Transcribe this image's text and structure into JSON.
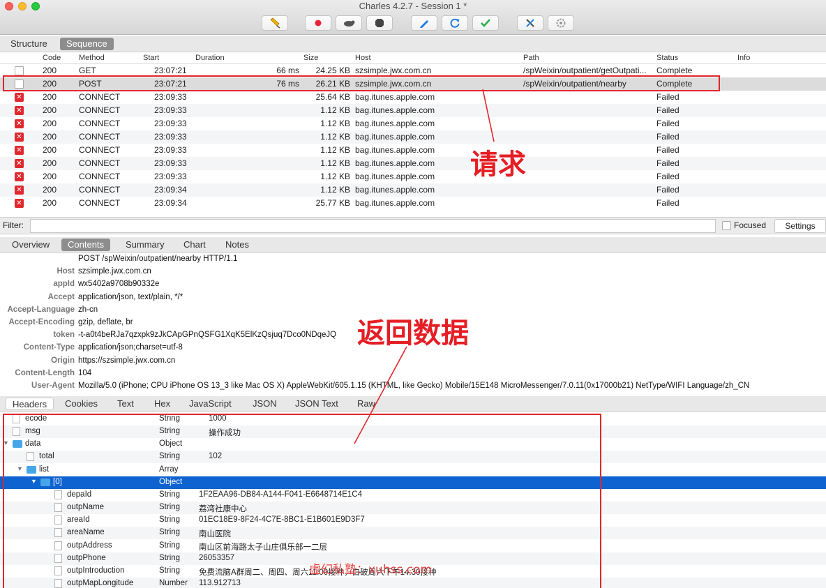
{
  "window": {
    "title": "Charles 4.2.7 - Session 1 *"
  },
  "toolbar": {
    "buttons": [
      "pen-icon",
      "record-icon",
      "throttle-icon",
      "stop-icon",
      "edit-icon",
      "refresh-icon",
      "validate-icon",
      "tools-icon",
      "settings-icon"
    ]
  },
  "view_tabs": {
    "structure": "Structure",
    "sequence": "Sequence"
  },
  "table": {
    "headers": {
      "code": "Code",
      "method": "Method",
      "start": "Start",
      "duration": "Duration",
      "size": "Size",
      "host": "Host",
      "path": "Path",
      "status": "Status",
      "info": "Info"
    },
    "rows": [
      {
        "code": "200",
        "method": "GET",
        "start": "23:07:21",
        "duration": "66 ms",
        "size": "24.25 KB",
        "host": "szsimple.jwx.com.cn",
        "path": "/spWeixin/outpatient/getOutpati...",
        "status": "Complete",
        "failed": false
      },
      {
        "code": "200",
        "method": "POST",
        "start": "23:07:21",
        "duration": "76 ms",
        "size": "26.21 KB",
        "host": "szsimple.jwx.com.cn",
        "path": "/spWeixin/outpatient/nearby",
        "status": "Complete",
        "failed": false
      },
      {
        "code": "200",
        "method": "CONNECT",
        "start": "23:09:33",
        "duration": "",
        "size": "25.64 KB",
        "host": "bag.itunes.apple.com",
        "path": "",
        "status": "Failed",
        "failed": true
      },
      {
        "code": "200",
        "method": "CONNECT",
        "start": "23:09:33",
        "duration": "",
        "size": "1.12 KB",
        "host": "bag.itunes.apple.com",
        "path": "",
        "status": "Failed",
        "failed": true
      },
      {
        "code": "200",
        "method": "CONNECT",
        "start": "23:09:33",
        "duration": "",
        "size": "1.12 KB",
        "host": "bag.itunes.apple.com",
        "path": "",
        "status": "Failed",
        "failed": true
      },
      {
        "code": "200",
        "method": "CONNECT",
        "start": "23:09:33",
        "duration": "",
        "size": "1.12 KB",
        "host": "bag.itunes.apple.com",
        "path": "",
        "status": "Failed",
        "failed": true
      },
      {
        "code": "200",
        "method": "CONNECT",
        "start": "23:09:33",
        "duration": "",
        "size": "1.12 KB",
        "host": "bag.itunes.apple.com",
        "path": "",
        "status": "Failed",
        "failed": true
      },
      {
        "code": "200",
        "method": "CONNECT",
        "start": "23:09:33",
        "duration": "",
        "size": "1.12 KB",
        "host": "bag.itunes.apple.com",
        "path": "",
        "status": "Failed",
        "failed": true
      },
      {
        "code": "200",
        "method": "CONNECT",
        "start": "23:09:33",
        "duration": "",
        "size": "1.12 KB",
        "host": "bag.itunes.apple.com",
        "path": "",
        "status": "Failed",
        "failed": true
      },
      {
        "code": "200",
        "method": "CONNECT",
        "start": "23:09:34",
        "duration": "",
        "size": "1.12 KB",
        "host": "bag.itunes.apple.com",
        "path": "",
        "status": "Failed",
        "failed": true
      },
      {
        "code": "200",
        "method": "CONNECT",
        "start": "23:09:34",
        "duration": "",
        "size": "25.77 KB",
        "host": "bag.itunes.apple.com",
        "path": "",
        "status": "Failed",
        "failed": true
      }
    ],
    "selected_index": 1
  },
  "filter": {
    "label": "Filter:",
    "value": "",
    "focused_label": "Focused",
    "settings_label": "Settings"
  },
  "detail_tabs": [
    "Overview",
    "Contents",
    "Summary",
    "Chart",
    "Notes"
  ],
  "detail_active": "Contents",
  "request": {
    "request_line": "POST /spWeixin/outpatient/nearby HTTP/1.1",
    "headers": [
      {
        "name": "Host",
        "value": "szsimple.jwx.com.cn"
      },
      {
        "name": "appId",
        "value": "wx5402a9708b90332e"
      },
      {
        "name": "Accept",
        "value": "application/json, text/plain, */*"
      },
      {
        "name": "Accept-Language",
        "value": "zh-cn"
      },
      {
        "name": "Accept-Encoding",
        "value": "gzip, deflate, br"
      },
      {
        "name": "token",
        "value": "-t-a0t4beRJa7qzxpk9zJkCApGPnQSFG1XqK5ElKzQsjuq7Dco0NDqeJQ"
      },
      {
        "name": "Content-Type",
        "value": "application/json;charset=utf-8"
      },
      {
        "name": "Origin",
        "value": "https://szsimple.jwx.com.cn"
      },
      {
        "name": "Content-Length",
        "value": "104"
      },
      {
        "name": "User-Agent",
        "value": "Mozilla/5.0 (iPhone; CPU iPhone OS 13_3 like Mac OS X) AppleWebKit/605.1.15 (KHTML, like Gecko) Mobile/15E148 MicroMessenger/7.0.11(0x17000b21) NetType/WIFI Language/zh_CN"
      }
    ]
  },
  "response_tabs": [
    "Headers",
    "Cookies",
    "Text",
    "Hex",
    "JavaScript",
    "JSON",
    "JSON Text",
    "Raw"
  ],
  "response_active": "Headers",
  "tree": [
    {
      "key": "ecode",
      "type": "String",
      "value": "1000",
      "depth": 0,
      "kind": "leaf"
    },
    {
      "key": "msg",
      "type": "String",
      "value": "操作成功",
      "depth": 0,
      "kind": "leaf"
    },
    {
      "key": "data",
      "type": "Object",
      "value": "",
      "depth": 0,
      "kind": "folder"
    },
    {
      "key": "total",
      "type": "String",
      "value": "102",
      "depth": 1,
      "kind": "leaf"
    },
    {
      "key": "list",
      "type": "Array",
      "value": "",
      "depth": 1,
      "kind": "folder"
    },
    {
      "key": "[0]",
      "type": "Object",
      "value": "",
      "depth": 2,
      "kind": "folder",
      "selected": true
    },
    {
      "key": "depaId",
      "type": "String",
      "value": "1F2EAA96-DB84-A144-F041-E6648714E1C4",
      "depth": 3,
      "kind": "leaf"
    },
    {
      "key": "outpName",
      "type": "String",
      "value": "荔湾社康中心",
      "depth": 3,
      "kind": "leaf"
    },
    {
      "key": "areaId",
      "type": "String",
      "value": "01EC18E9-8F24-4C7E-8BC1-E1B601E9D3F7",
      "depth": 3,
      "kind": "leaf"
    },
    {
      "key": "areaName",
      "type": "String",
      "value": "南山医院",
      "depth": 3,
      "kind": "leaf"
    },
    {
      "key": "outpAddress",
      "type": "String",
      "value": "南山区前海路太子山庄俱乐部一二层",
      "depth": 3,
      "kind": "leaf"
    },
    {
      "key": "outpPhone",
      "type": "String",
      "value": "26053357",
      "depth": 3,
      "kind": "leaf"
    },
    {
      "key": "outpIntroduction",
      "type": "String",
      "value": "免费流脑A群周二、周四、周六11:00接种，白破周六下午14:30接种",
      "depth": 3,
      "kind": "leaf"
    },
    {
      "key": "outpMapLongitude",
      "type": "Number",
      "value": "113.912713",
      "depth": 3,
      "kind": "leaf"
    }
  ],
  "annotations": {
    "request": "请求",
    "response": "返回数据",
    "watermark": "虚幻私塾：xuhss.com"
  },
  "colors": {
    "annotation_red": "#e2252b",
    "selection_blue": "#0f63d0",
    "failed_red": "#e0282f",
    "folder_blue": "#47a6e8"
  }
}
